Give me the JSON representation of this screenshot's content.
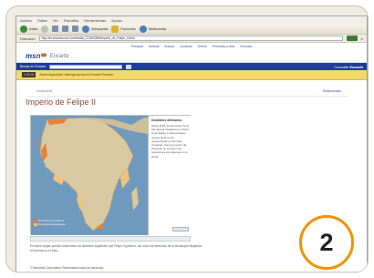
{
  "browser": {
    "menu": [
      "Archivo",
      "Editar",
      "Ver",
      "Favoritos",
      "Herramientas",
      "Ayuda"
    ],
    "toolbar": {
      "back_label": "Atrás",
      "search_label": "Búsqueda",
      "favorites_label": "Favoritos",
      "multimedia_label": "Multimedia"
    },
    "address": {
      "label": "Dirección",
      "url": "http://es.encarta.msn.com/media_121501983/Imperio_de_Felipe_II.html",
      "go_label": "Ir"
    }
  },
  "msn": {
    "links": [
      "Principal",
      "Hotmail",
      "Buscar",
      "Compras",
      "Dinero",
      "Personas y chat",
      "Vínculos"
    ],
    "logo": "msn",
    "brand": "Encarta",
    "search_label": "Buscar en Encarta",
    "consult_prefix": "Consulte",
    "consult_brand": "Encarta"
  },
  "banner": {
    "badge": "1.00.00",
    "text": "Ahora disponible: obtenga acceso a Encarta Premium"
  },
  "page": {
    "crumb": "Multimedia",
    "crumb_right": "Relacionado",
    "title": "Imperio de Felipe II"
  },
  "media": {
    "panel_title": "Dominios africanos",
    "panel_text": "Hacia 1581, los dominios de la Monarquía hispánica en África se limitaban a determinados puntos de la costa septentrional y a las islas Canarias. Tras la anexión de Portugal, se sumaron las posesiones portuguesas en el litoral.",
    "caption": "",
    "legend": [
      {
        "label": "Dominios de Felipe II",
        "color": "#e5803f"
      },
      {
        "label": "Dominios portugueses",
        "color": "#f2c27a"
      }
    ]
  },
  "article": {
    "text": "En estos mapas pueden observarse los dominios españoles que Felipe II gobernó, así como los territorios de la Monarquía hispánica en América y en Asia.",
    "note": "© Microsoft Corporation. Reservados todos los derechos."
  },
  "callout": {
    "number": "2"
  },
  "colors": {
    "accent": "#f29200",
    "header_blue": "#1f3f8f",
    "title_color": "#8a4a3a",
    "banner_yellow": "#f2d96b"
  }
}
